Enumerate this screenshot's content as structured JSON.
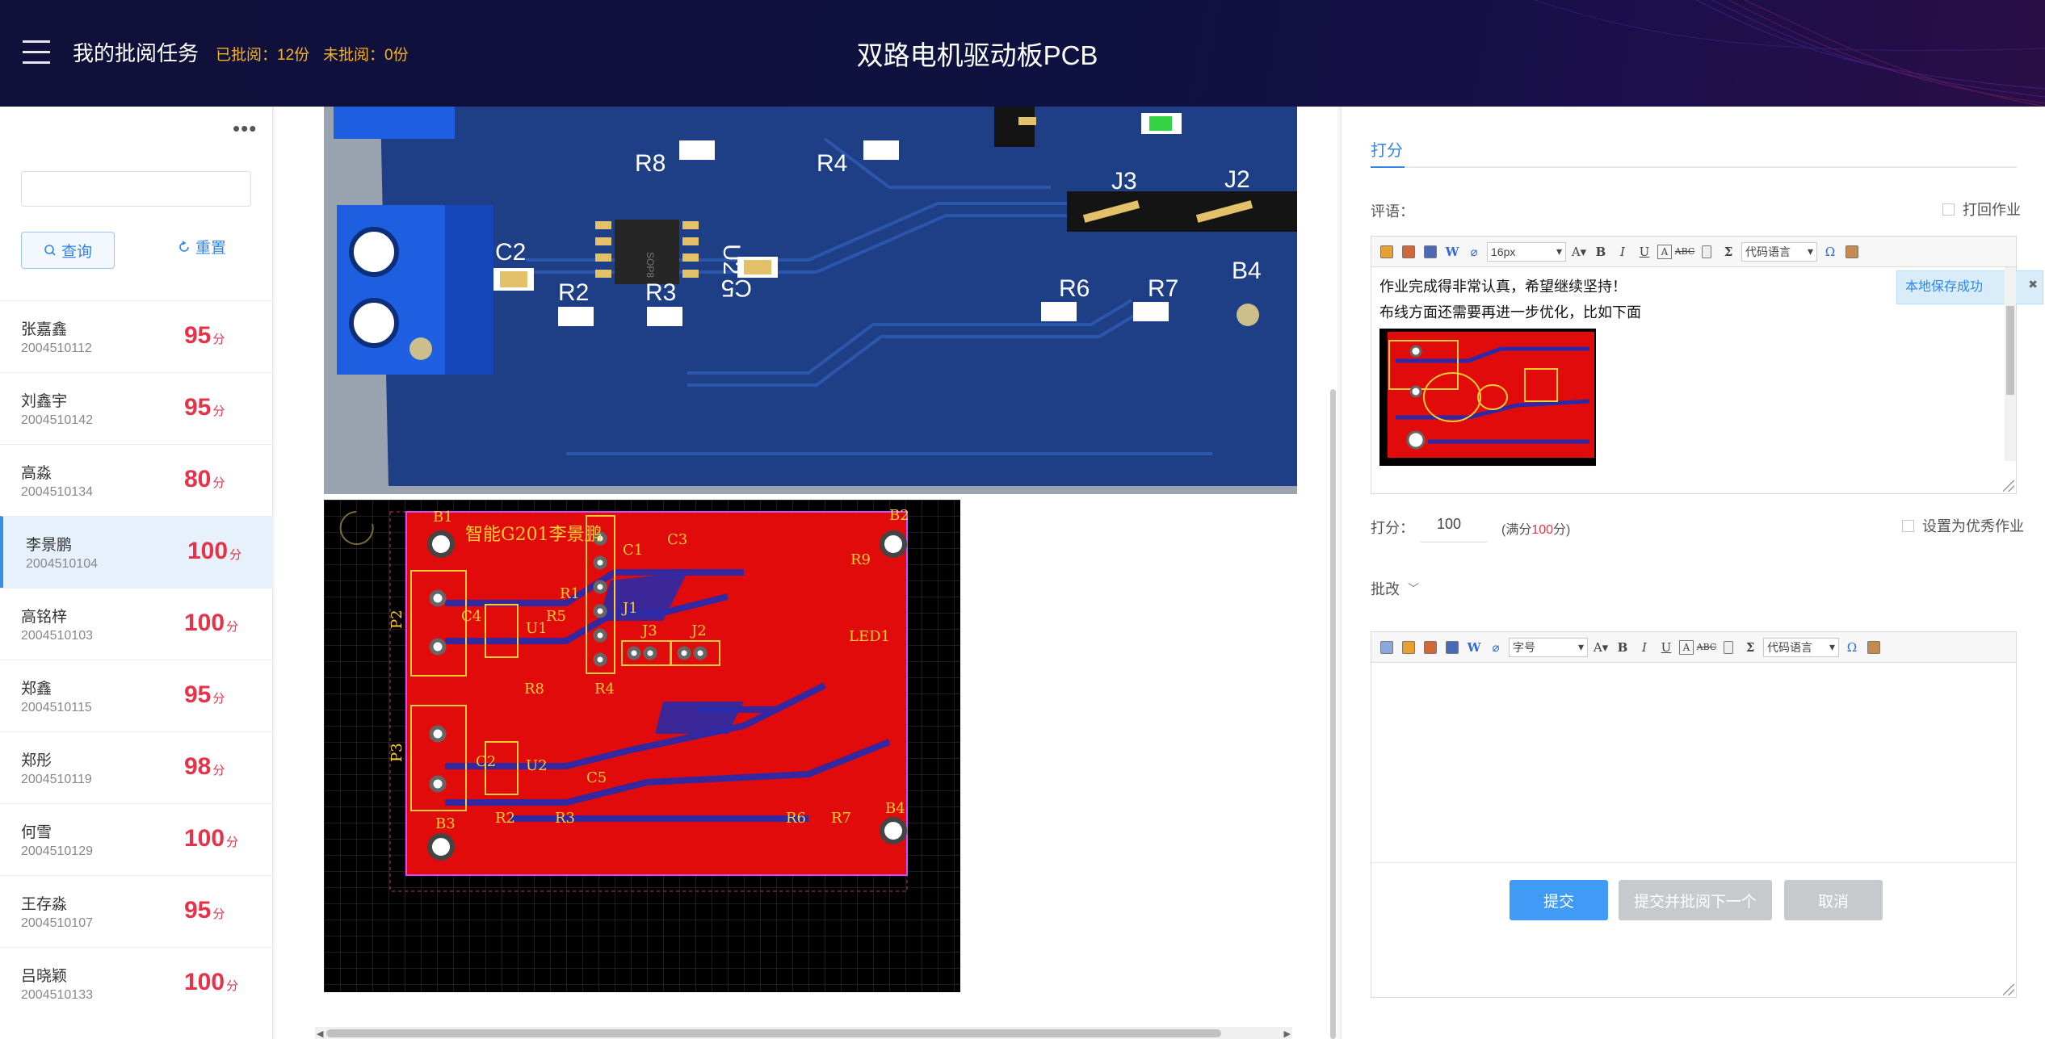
{
  "header": {
    "title": "我的批阅任务",
    "reviewed": "已批阅：12份",
    "unreviewed": "未批阅：0份",
    "doc_title": "双路电机驱动板PCB"
  },
  "sidebar": {
    "query_label": "查询",
    "reset_label": "重置",
    "score_unit": "分",
    "students": [
      {
        "name": "张嘉鑫",
        "id": "2004510112",
        "score": "95"
      },
      {
        "name": "刘鑫宇",
        "id": "2004510142",
        "score": "95"
      },
      {
        "name": "高淼",
        "id": "2004510134",
        "score": "80"
      },
      {
        "name": "李景鹏",
        "id": "2004510104",
        "score": "100"
      },
      {
        "name": "高铭梓",
        "id": "2004510103",
        "score": "100"
      },
      {
        "name": "郑鑫",
        "id": "2004510115",
        "score": "95"
      },
      {
        "name": "郑彤",
        "id": "2004510119",
        "score": "98"
      },
      {
        "name": "何雪",
        "id": "2004510129",
        "score": "100"
      },
      {
        "name": "王存淼",
        "id": "2004510107",
        "score": "95"
      },
      {
        "name": "吕晓颖",
        "id": "2004510133",
        "score": "100"
      }
    ]
  },
  "pcb3d": {
    "labels": [
      "R8",
      "R4",
      "J3",
      "J2",
      "C2",
      "U2",
      "C5",
      "R2",
      "R3",
      "R6",
      "R7",
      "B4",
      "SOP8"
    ]
  },
  "pcb2d": {
    "title": "智能G201李景鹏",
    "labels": [
      "B1",
      "B2",
      "B3",
      "B4",
      "P2",
      "P3",
      "C1",
      "C3",
      "C4",
      "C5",
      "C2",
      "R9",
      "R1",
      "R5",
      "J1",
      "U1",
      "U2",
      "LED1",
      "R8",
      "R4",
      "J3",
      "J2",
      "R2",
      "R3",
      "R6",
      "R7"
    ]
  },
  "panel": {
    "tab_label": "打分",
    "comment_label": "评语：",
    "return_label": "打回作业",
    "font_size": "16px",
    "code_lang": "代码语言",
    "comment_line1": "作业完成得非常认真，希望继续坚持！",
    "comment_line2": "布线方面还需要再进一步优化，比如下面",
    "toast": "本地保存成功",
    "score_label": "打分：",
    "score_value": "100",
    "full_prefix": "(满分",
    "full_value": "100",
    "full_suffix": "分)",
    "excellent_label": "设置为优秀作业",
    "annotate_label": "批改",
    "font_label": "字号",
    "code_lang2": "代码语言",
    "submit_label": "提交",
    "submit_next_label": "提交并批阅下一个",
    "cancel_label": "取消"
  }
}
